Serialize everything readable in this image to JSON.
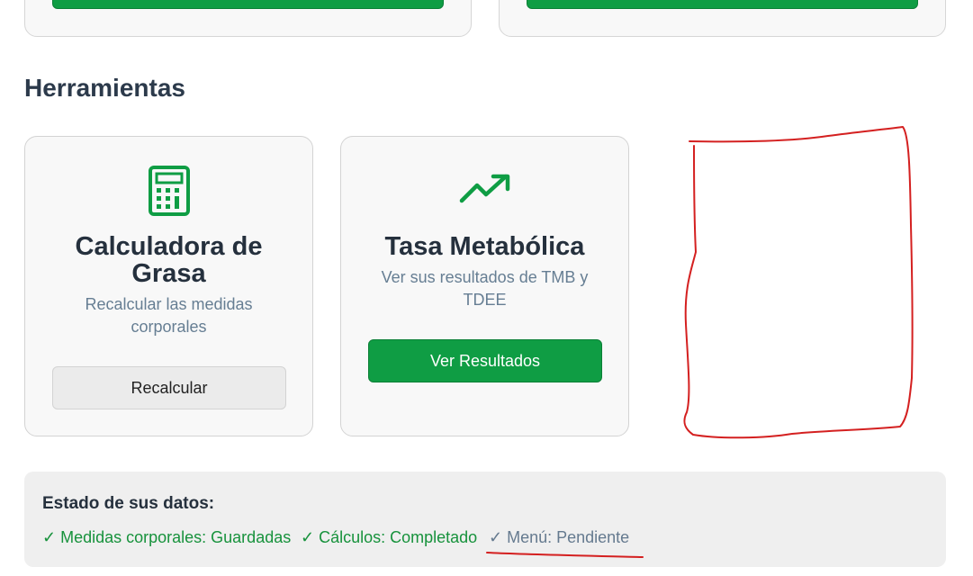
{
  "section": {
    "title": "Herramientas"
  },
  "tools": [
    {
      "title": "Calculadora de Grasa",
      "description": "Recalcular las medidas corporales",
      "button": "Recalcular",
      "icon": "calculator-icon"
    },
    {
      "title": "Tasa Metabólica",
      "description": "Ver sus resultados de TMB y TDEE",
      "button": "Ver Resultados",
      "icon": "trending-up-icon"
    }
  ],
  "status": {
    "title": "Estado de sus datos:",
    "items": [
      {
        "label": "✓ Medidas corporales: Guardadas",
        "state": "done"
      },
      {
        "label": "✓ Cálculos: Completado",
        "state": "done"
      },
      {
        "label": "✓ Menú: Pendiente",
        "state": "pending"
      }
    ]
  },
  "colors": {
    "primary_green": "#0f9d44",
    "heading": "#25303d",
    "muted": "#667e93",
    "annotation_red": "#d42020"
  }
}
